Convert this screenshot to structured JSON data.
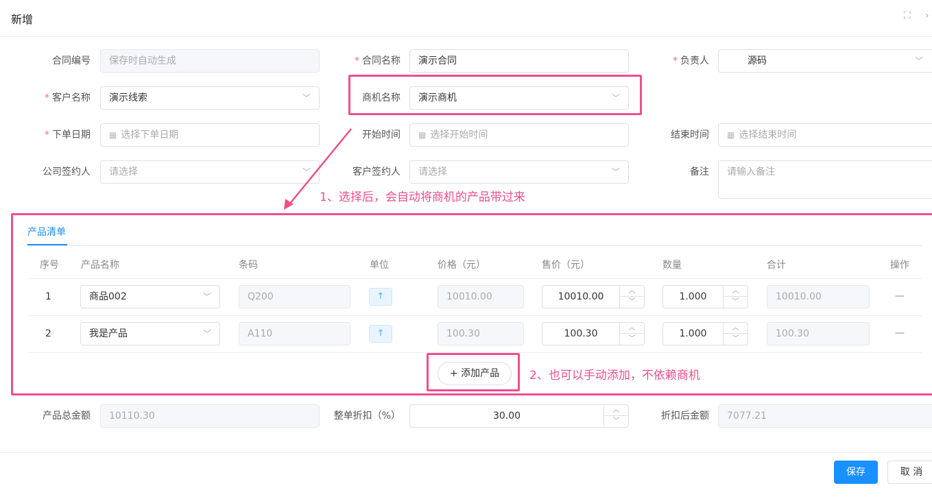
{
  "dialog": {
    "title": "新增",
    "fullscreen_icon": "fullscreen-icon",
    "close_icon": "close-icon"
  },
  "form": {
    "contract_no": {
      "label": "合同编号",
      "placeholder": "保存时自动生成"
    },
    "contract_name": {
      "label": "合同名称",
      "required": "*",
      "value": "演示合同"
    },
    "owner": {
      "label": "负责人",
      "required": "*",
      "value": "源码"
    },
    "customer": {
      "label": "客户名称",
      "required": "*",
      "value": "演示线索"
    },
    "opportunity": {
      "label": "商机名称",
      "value": "演示商机"
    },
    "order_date": {
      "label": "下单日期",
      "required": "*",
      "placeholder": "选择下单日期"
    },
    "start_time": {
      "label": "开始时间",
      "placeholder": "选择开始时间"
    },
    "end_time": {
      "label": "结束时间",
      "placeholder": "选择结束时间"
    },
    "company_signer": {
      "label": "公司签约人",
      "placeholder": "请选择"
    },
    "customer_signer": {
      "label": "客户签约人",
      "placeholder": "请选择"
    },
    "remark": {
      "label": "备注",
      "placeholder": "请输入备注"
    }
  },
  "annotations": {
    "note1": "1、选择后，会自动将商机的产品带过来",
    "note2": "2、也可以手动添加，不依赖商机"
  },
  "products": {
    "tab": "产品清单",
    "columns": {
      "no": "序号",
      "name": "产品名称",
      "barcode": "条码",
      "unit": "单位",
      "price": "价格（元）",
      "sale_price": "售价（元）",
      "qty": "数量",
      "total": "合计",
      "op": "操作"
    },
    "rows": [
      {
        "no": "1",
        "name": "商品002",
        "barcode": "Q200",
        "price": "10010.00",
        "sale_price": "10010.00",
        "qty": "1.000",
        "total": "10010.00",
        "op": "—"
      },
      {
        "no": "2",
        "name": "我是产品",
        "barcode": "A110",
        "price": "100.30",
        "sale_price": "100.30",
        "qty": "1.000",
        "total": "100.30",
        "op": "—"
      }
    ],
    "add_button": "+ 添加产品"
  },
  "summary": {
    "total_label": "产品总金额",
    "total_value": "10110.30",
    "discount_label": "整单折扣（%）",
    "discount_value": "30.00",
    "after_label": "折扣后金额",
    "after_value": "7077.21"
  },
  "footer": {
    "save": "保存",
    "cancel": "取 消"
  },
  "colors": {
    "primary": "#1890ff",
    "annotation": "#f04e8e",
    "required": "#f56c6c"
  }
}
